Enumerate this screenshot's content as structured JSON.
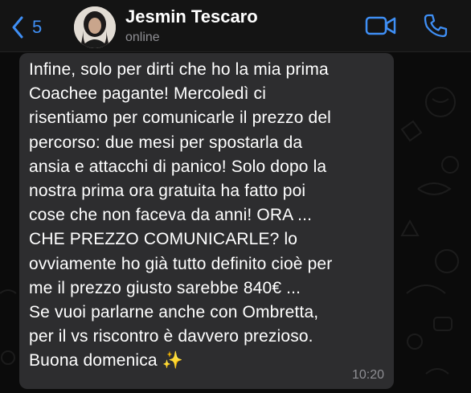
{
  "header": {
    "back_count": "5",
    "contact_name": "Jesmin Tescaro",
    "status": "online",
    "icons": {
      "back": "chevron-left-icon",
      "video": "video-camera-icon",
      "call": "phone-icon"
    },
    "accent_color": "#3f8ff5"
  },
  "message": {
    "text": "Infine, solo per dirti che ho la mia prima\nCoachee pagante! Mercoledì ci\nrisentiamo per comunicarle il prezzo del\npercorso: due mesi per spostarla da\nansia e attacchi di panico! Solo dopo la\nnostra prima ora gratuita ha fatto poi\ncose che non faceva da anni! ORA ...\nCHE PREZZO COMUNICARLE? lo\novviamente ho già tutto definito cioè per\nme il prezzo giusto sarebbe 840€ ...\nSe vuoi parlarne anche con Ombretta,\nper il vs riscontro è davvero prezioso.\nBuona domenica ✨",
    "time": "10:20",
    "bubble_color": "#2d2d2f"
  }
}
